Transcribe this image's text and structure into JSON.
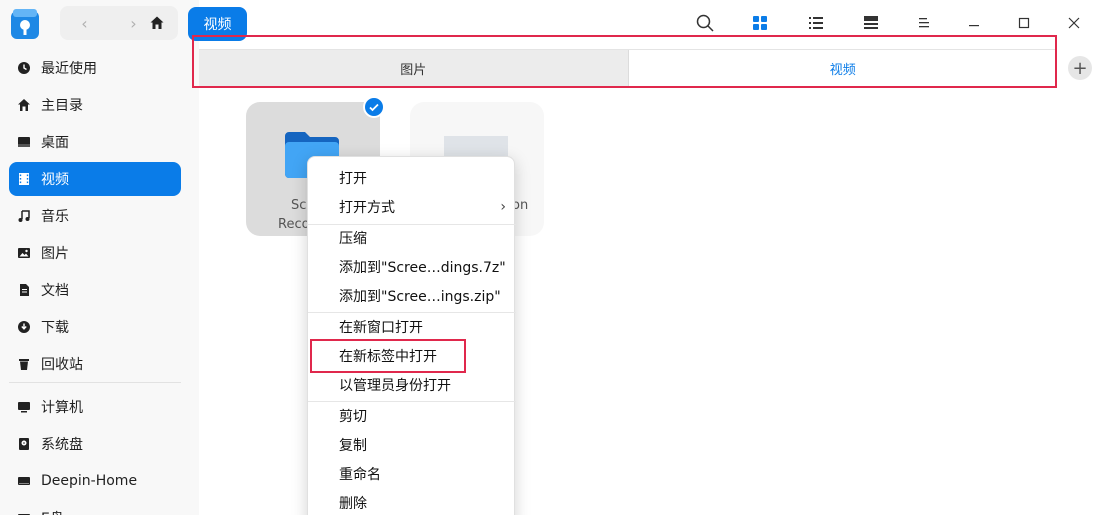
{
  "titlebar": {
    "breadcrumb": "视频",
    "nav_back": "‹",
    "nav_forward": "›"
  },
  "sidebar": {
    "items": [
      {
        "label": "最近使用",
        "icon": "clock-icon"
      },
      {
        "label": "主目录",
        "icon": "home-icon"
      },
      {
        "label": "桌面",
        "icon": "desktop-icon"
      },
      {
        "label": "视频",
        "icon": "film-icon",
        "active": true
      },
      {
        "label": "音乐",
        "icon": "music-icon"
      },
      {
        "label": "图片",
        "icon": "picture-icon"
      },
      {
        "label": "文档",
        "icon": "document-icon"
      },
      {
        "label": "下载",
        "icon": "download-icon"
      },
      {
        "label": "回收站",
        "icon": "trash-icon"
      },
      {
        "label": "计算机",
        "icon": "computer-icon"
      },
      {
        "label": "系统盘",
        "icon": "disk-icon"
      },
      {
        "label": "Deepin-Home",
        "icon": "drive-icon"
      },
      {
        "label": "E盘",
        "icon": "drive-icon"
      }
    ]
  },
  "tabs": [
    {
      "label": "图片",
      "active": false
    },
    {
      "label": "视频",
      "active": true
    }
  ],
  "add_tab": "+",
  "files": [
    {
      "label_line1": "Scr",
      "label_line2": "Reco"
    },
    {
      "label_partial": "on"
    }
  ],
  "context_menu": {
    "items": [
      {
        "label": "打开"
      },
      {
        "label": "打开方式",
        "submenu": true,
        "arrow": "›"
      },
      {
        "label": "压缩"
      },
      {
        "label": "添加到\"Scree…dings.7z\""
      },
      {
        "label": "添加到\"Scree…ings.zip\""
      },
      {
        "label": "在新窗口打开"
      },
      {
        "label": "在新标签中打开"
      },
      {
        "label": "以管理员身份打开"
      },
      {
        "label": "剪切"
      },
      {
        "label": "复制"
      },
      {
        "label": "重命名"
      },
      {
        "label": "删除"
      }
    ]
  },
  "colors": {
    "accent": "#0a7ce8",
    "highlight_box": "#e0284c"
  }
}
